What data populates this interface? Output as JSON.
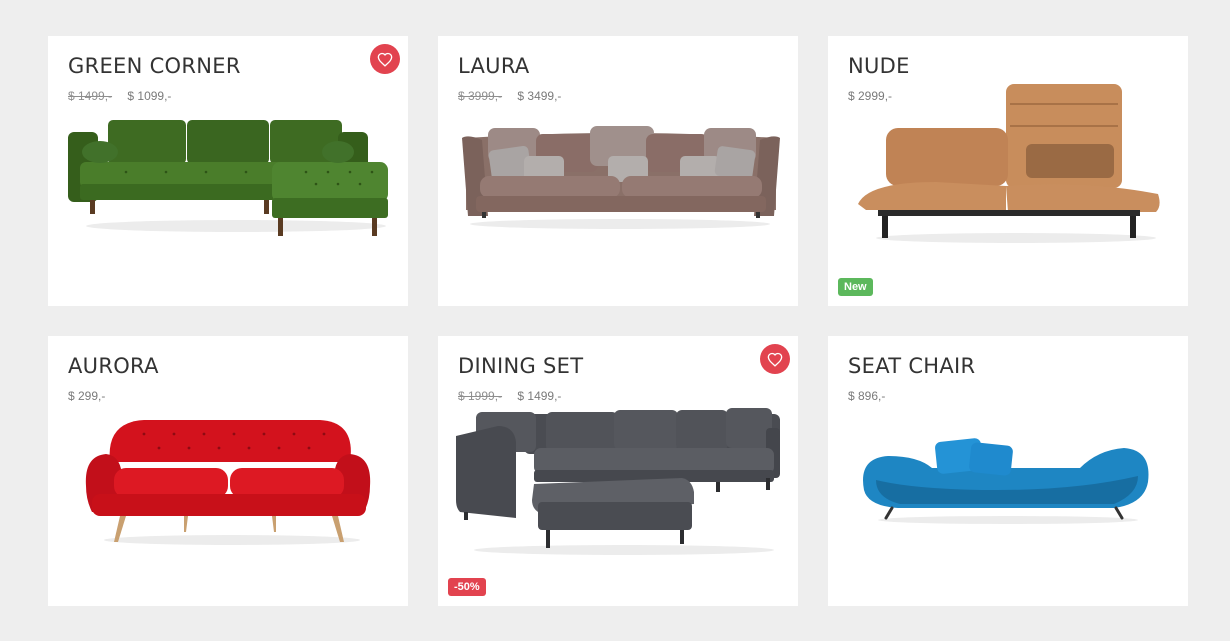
{
  "colors": {
    "heart": "#e2434f",
    "badge_new": "#5cb85c",
    "badge_sale": "#e2434f",
    "card_bg": "#ffffff",
    "page_bg": "#eeeeee"
  },
  "products": [
    {
      "name": "GREEN CORNER",
      "old_price": "$ 1499,-",
      "price": "$ 1099,-",
      "wishlisted": true,
      "image": "green-corner-sofa"
    },
    {
      "name": "LAURA",
      "old_price": "$ 3999,-",
      "price": "$ 3499,-",
      "image": "taupe-sofa"
    },
    {
      "name": "NUDE",
      "price": "$ 2999,-",
      "badge": "New",
      "image": "tan-reclining-sofa"
    },
    {
      "name": "AURORA",
      "price": "$ 299,-",
      "image": "red-tufted-sofa"
    },
    {
      "name": "DINING SET",
      "old_price": "$ 1999,-",
      "price": "$ 1499,-",
      "wishlisted": true,
      "badge": "-50%",
      "image": "grey-sectional-sofa"
    },
    {
      "name": "SEAT CHAIR",
      "price": "$ 896,-",
      "image": "blue-curved-sofa"
    }
  ]
}
